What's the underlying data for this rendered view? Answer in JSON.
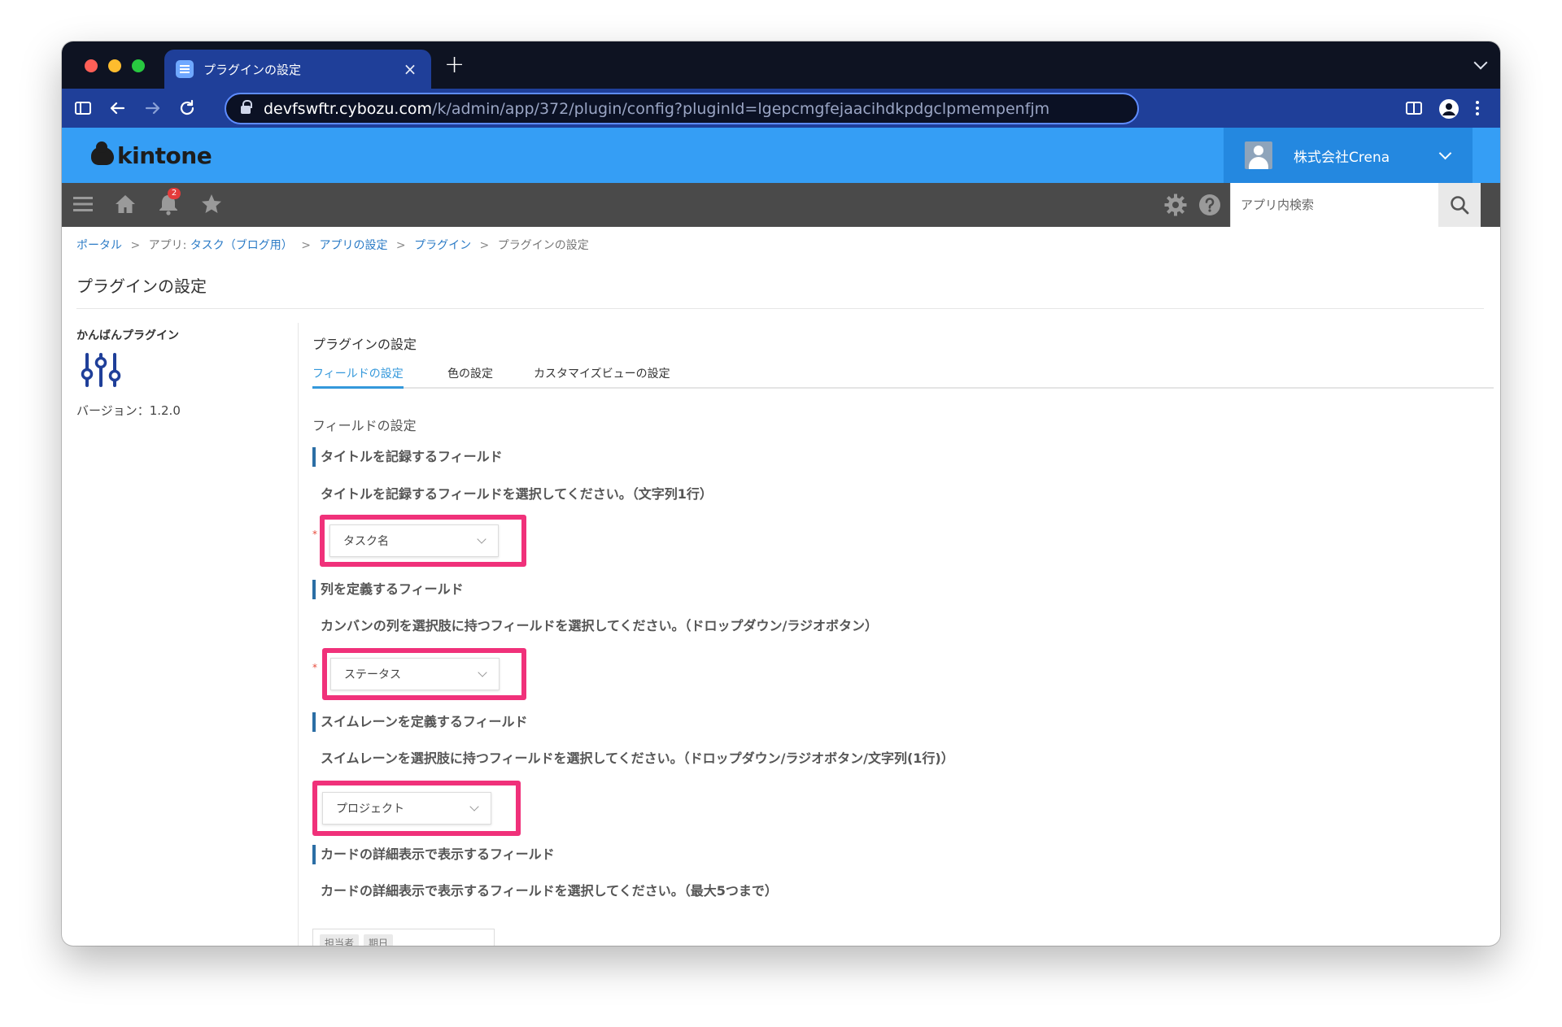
{
  "browser": {
    "tab_title": "プラグインの設定",
    "url_host": "devfswftr.cybozu.com",
    "url_path": "/k/admin/app/372/plugin/config?pluginId=lgepcmgfejaacihdkpdgclpmempenfjm",
    "traffic_lights": [
      "#ff5f57",
      "#febc2e",
      "#28c840"
    ]
  },
  "header": {
    "logo_text": "kintone",
    "company": "株式会社Crena"
  },
  "gnav": {
    "notification_count": "2",
    "search_placeholder": "アプリ内検索"
  },
  "breadcrumb": {
    "portal": "ポータル",
    "app_prefix": "アプリ:",
    "app_name": "タスク（ブログ用）",
    "app_settings": "アプリの設定",
    "plugin": "プラグイン",
    "current": "プラグインの設定",
    "separator": ">"
  },
  "page": {
    "title": "プラグインの設定"
  },
  "sidebar": {
    "plugin_name": "かんばんプラグイン",
    "version": "バージョン：1.2.0"
  },
  "content": {
    "heading": "プラグインの設定",
    "tabs": [
      {
        "label": "フィールドの設定",
        "active": true
      },
      {
        "label": "色の設定",
        "active": false
      },
      {
        "label": "カスタマイズビューの設定",
        "active": false
      }
    ],
    "section_title": "フィールドの設定",
    "fields": [
      {
        "title": "タイトルを記録するフィールド",
        "description": "タイトルを記録するフィールドを選択してください。（文字列1行）",
        "required": true,
        "selected": "タスク名"
      },
      {
        "title": "列を定義するフィールド",
        "description": "カンバンの列を選択肢に持つフィールドを選択してください。（ドロップダウン/ラジオボタン）",
        "required": true,
        "selected": "ステータス"
      },
      {
        "title": "スイムレーンを定義するフィールド",
        "description": "スイムレーンを選択肢に持つフィールドを選択してください。（ドロップダウン/ラジオボタン/文字列(1行)）",
        "required": false,
        "selected": "プロジェクト"
      },
      {
        "title": "カードの詳細表示で表示するフィールド",
        "description": "カードの詳細表示で表示するフィールドを選択してください。（最大5つまで）"
      }
    ],
    "required_mark": "*",
    "chips": [
      "担当者",
      "期日"
    ]
  },
  "colors": {
    "header_blue": "#359ef5",
    "nav_gray": "#4a4a4a",
    "highlight_pink": "#f0317a",
    "link_blue": "#2b7bc6",
    "tab_active": "#3498db"
  }
}
